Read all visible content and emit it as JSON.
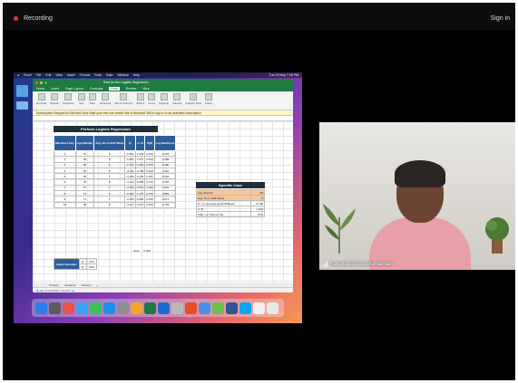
{
  "recording": {
    "label": "Recording"
  },
  "signin": {
    "label": "Sign in"
  },
  "mac_menu": {
    "items": [
      "Excel",
      "File",
      "Edit",
      "View",
      "Insert",
      "Format",
      "Tools",
      "Data",
      "Window",
      "Help"
    ],
    "clock": "Tue 23 May 7:48 PM"
  },
  "excel": {
    "window_title": "Real for the Logistic Regression",
    "tabs": [
      "Home",
      "Insert",
      "Page Layout",
      "Formulas",
      "Data",
      "Review",
      "View"
    ],
    "active_tab": "Data",
    "ribbon": [
      "Get Data",
      "Refresh",
      "Properties",
      "Sort",
      "Filter",
      "Advanced",
      "Text to Columns",
      "What-If",
      "Group",
      "Ungroup",
      "Subtotal",
      "Analysis Tools",
      "Solver"
    ],
    "notice": "Subscription Required to Edit and Save   Start your free one-month trial of Microsoft 365 or sign in to an activated subscription",
    "title": "Perform Logistic Regression",
    "headers": [
      "Machine's Key",
      "Age (Month)",
      "Avg. No of Drill/ Week",
      "R",
      "e^-R",
      "P(R)",
      "Log likelihood"
    ],
    "rows": [
      [
        "1",
        "70",
        "5",
        "0.450",
        "1.032",
        "0.633",
        "-0.478"
      ],
      [
        "2",
        "39",
        "4",
        "0.456",
        "1.577",
        "0.612",
        "-0.489"
      ],
      [
        "3",
        "68",
        "6",
        "0.719",
        "2.250",
        "0.675",
        "-0.490"
      ],
      [
        "4",
        "59",
        "6",
        "-0.011",
        "0.789",
        "0.613",
        "-0.310"
      ],
      [
        "5",
        "65",
        "7",
        "-0.380",
        "0.433",
        "0.387",
        "-0.333"
      ],
      [
        "6",
        "78",
        "8",
        "-0.112",
        "0.895",
        "0.472",
        "-0.752"
      ],
      [
        "7",
        "57",
        "7",
        "-0.429",
        "0.651",
        "0.394",
        "-0.051"
      ],
      [
        "8",
        "73",
        "6",
        "0.290",
        "1.167",
        "0.576",
        "-0.853"
      ],
      [
        "9",
        "71",
        "7",
        "-0.034",
        "0.966",
        "0.495",
        "-0.674"
      ],
      [
        "10",
        "38",
        "9",
        "-0.117",
        "0.672",
        "0.464",
        "-0.739"
      ]
    ],
    "total_label": "Total",
    "total_value": "-6.023",
    "solver": [
      {
        "label": "Select Variables",
        "name": "β₀",
        "value": "0.00"
      },
      {
        "label": "",
        "name": "β₁",
        "value": "0.00"
      }
    ],
    "specific_case": {
      "title": "Specific Case",
      "rows": [
        {
          "label": "Age (Month)",
          "value": "65",
          "highlight": true
        },
        {
          "label": "Avg. No of Drill/ Week",
          "value": "6",
          "highlight": true
        },
        {
          "label": "R = β₀+β₁(Age)+β₂(Drill/Week)",
          "value": "0.718",
          "highlight": false
        },
        {
          "label": "e^-R",
          "value": "1.613",
          "highlight": false
        },
        {
          "label": "P(R) = e^-R/(1+e^-R)",
          "value": "37%",
          "highlight": false
        }
      ]
    },
    "sheet_tabs": [
      "Problem",
      "Analysis",
      "Solution",
      "+"
    ],
    "active_sheet": "Analysis",
    "status": "Ready   Accessibility: Good to go"
  },
  "colors": {
    "excel_green": "#1f7a44",
    "header_blue": "#2f5d9a",
    "highlight": "#f6c89a",
    "rec_red": "#e33333"
  },
  "dock_colors": [
    "#2d7de8",
    "#5b5b5b",
    "#e8534b",
    "#3aa0f0",
    "#36c15a",
    "#1d8fe8",
    "#8e8e93",
    "#f5a623",
    "#1f7a44",
    "#1e6bd6",
    "#b8b8b8",
    "#e44d26",
    "#4a90e2",
    "#6cc04a",
    "#2b5797",
    "#0aa8f0",
    "#f0f0f0",
    "#e8e8e8"
  ],
  "webcam": {
    "name": "Kanaka Balasubramanian"
  }
}
